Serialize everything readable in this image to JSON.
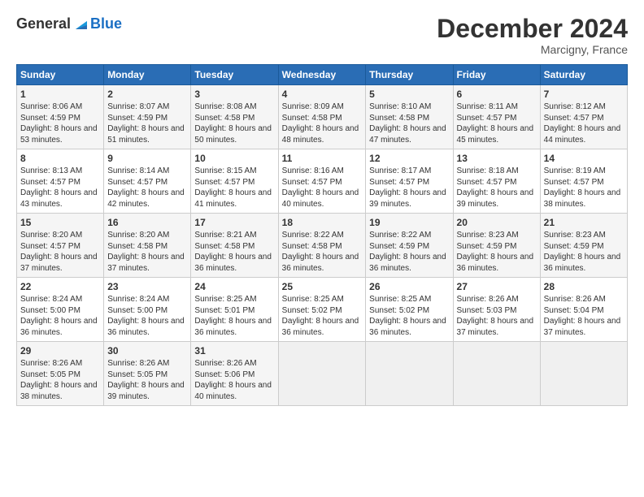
{
  "header": {
    "logo_general": "General",
    "logo_blue": "Blue",
    "month_year": "December 2024",
    "location": "Marcigny, France"
  },
  "calendar": {
    "days_of_week": [
      "Sunday",
      "Monday",
      "Tuesday",
      "Wednesday",
      "Thursday",
      "Friday",
      "Saturday"
    ],
    "weeks": [
      [
        null,
        null,
        null,
        {
          "day": "1",
          "sunrise": "8:06 AM",
          "sunset": "4:59 PM",
          "daylight": "8 hours and 53 minutes."
        },
        {
          "day": "2",
          "sunrise": "8:07 AM",
          "sunset": "4:59 PM",
          "daylight": "8 hours and 51 minutes."
        },
        {
          "day": "3",
          "sunrise": "8:08 AM",
          "sunset": "4:58 PM",
          "daylight": "8 hours and 50 minutes."
        },
        {
          "day": "4",
          "sunrise": "8:09 AM",
          "sunset": "4:58 PM",
          "daylight": "8 hours and 48 minutes."
        },
        {
          "day": "5",
          "sunrise": "8:10 AM",
          "sunset": "4:58 PM",
          "daylight": "8 hours and 47 minutes."
        },
        {
          "day": "6",
          "sunrise": "8:11 AM",
          "sunset": "4:57 PM",
          "daylight": "8 hours and 45 minutes."
        },
        {
          "day": "7",
          "sunrise": "8:12 AM",
          "sunset": "4:57 PM",
          "daylight": "8 hours and 44 minutes."
        }
      ],
      [
        {
          "day": "8",
          "sunrise": "8:13 AM",
          "sunset": "4:57 PM",
          "daylight": "8 hours and 43 minutes."
        },
        {
          "day": "9",
          "sunrise": "8:14 AM",
          "sunset": "4:57 PM",
          "daylight": "8 hours and 42 minutes."
        },
        {
          "day": "10",
          "sunrise": "8:15 AM",
          "sunset": "4:57 PM",
          "daylight": "8 hours and 41 minutes."
        },
        {
          "day": "11",
          "sunrise": "8:16 AM",
          "sunset": "4:57 PM",
          "daylight": "8 hours and 40 minutes."
        },
        {
          "day": "12",
          "sunrise": "8:17 AM",
          "sunset": "4:57 PM",
          "daylight": "8 hours and 39 minutes."
        },
        {
          "day": "13",
          "sunrise": "8:18 AM",
          "sunset": "4:57 PM",
          "daylight": "8 hours and 39 minutes."
        },
        {
          "day": "14",
          "sunrise": "8:19 AM",
          "sunset": "4:57 PM",
          "daylight": "8 hours and 38 minutes."
        }
      ],
      [
        {
          "day": "15",
          "sunrise": "8:20 AM",
          "sunset": "4:57 PM",
          "daylight": "8 hours and 37 minutes."
        },
        {
          "day": "16",
          "sunrise": "8:20 AM",
          "sunset": "4:58 PM",
          "daylight": "8 hours and 37 minutes."
        },
        {
          "day": "17",
          "sunrise": "8:21 AM",
          "sunset": "4:58 PM",
          "daylight": "8 hours and 36 minutes."
        },
        {
          "day": "18",
          "sunrise": "8:22 AM",
          "sunset": "4:58 PM",
          "daylight": "8 hours and 36 minutes."
        },
        {
          "day": "19",
          "sunrise": "8:22 AM",
          "sunset": "4:59 PM",
          "daylight": "8 hours and 36 minutes."
        },
        {
          "day": "20",
          "sunrise": "8:23 AM",
          "sunset": "4:59 PM",
          "daylight": "8 hours and 36 minutes."
        },
        {
          "day": "21",
          "sunrise": "8:23 AM",
          "sunset": "4:59 PM",
          "daylight": "8 hours and 36 minutes."
        }
      ],
      [
        {
          "day": "22",
          "sunrise": "8:24 AM",
          "sunset": "5:00 PM",
          "daylight": "8 hours and 36 minutes."
        },
        {
          "day": "23",
          "sunrise": "8:24 AM",
          "sunset": "5:00 PM",
          "daylight": "8 hours and 36 minutes."
        },
        {
          "day": "24",
          "sunrise": "8:25 AM",
          "sunset": "5:01 PM",
          "daylight": "8 hours and 36 minutes."
        },
        {
          "day": "25",
          "sunrise": "8:25 AM",
          "sunset": "5:02 PM",
          "daylight": "8 hours and 36 minutes."
        },
        {
          "day": "26",
          "sunrise": "8:25 AM",
          "sunset": "5:02 PM",
          "daylight": "8 hours and 36 minutes."
        },
        {
          "day": "27",
          "sunrise": "8:26 AM",
          "sunset": "5:03 PM",
          "daylight": "8 hours and 37 minutes."
        },
        {
          "day": "28",
          "sunrise": "8:26 AM",
          "sunset": "5:04 PM",
          "daylight": "8 hours and 37 minutes."
        }
      ],
      [
        {
          "day": "29",
          "sunrise": "8:26 AM",
          "sunset": "5:05 PM",
          "daylight": "8 hours and 38 minutes."
        },
        {
          "day": "30",
          "sunrise": "8:26 AM",
          "sunset": "5:05 PM",
          "daylight": "8 hours and 39 minutes."
        },
        {
          "day": "31",
          "sunrise": "8:26 AM",
          "sunset": "5:06 PM",
          "daylight": "8 hours and 40 minutes."
        },
        null,
        null,
        null,
        null
      ]
    ]
  }
}
